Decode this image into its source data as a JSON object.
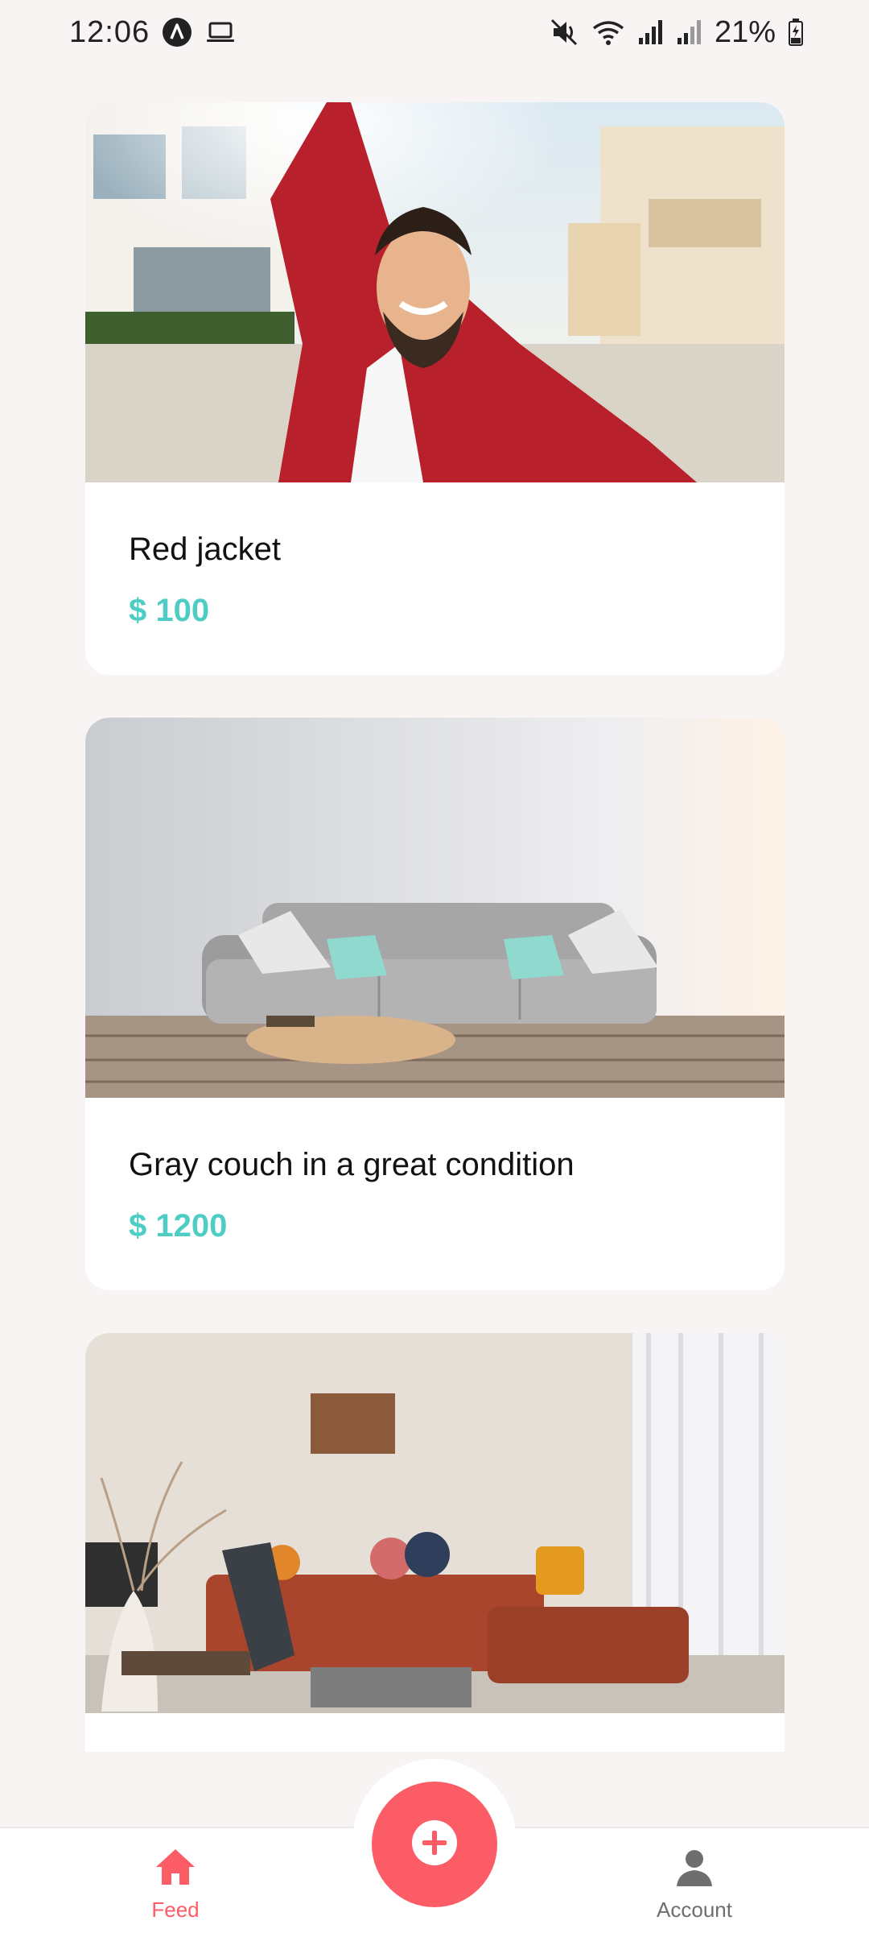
{
  "status_bar": {
    "time": "12:06",
    "battery": "21%",
    "icons_left": [
      "app-a-icon",
      "laptop-icon"
    ],
    "icons_right": [
      "mute-icon",
      "wifi-icon",
      "signal-icon",
      "signal-icon-2",
      "battery-icon"
    ]
  },
  "listings": [
    {
      "title": "Red jacket",
      "price": "$ 100",
      "image": "man-in-red-jacket-selfie"
    },
    {
      "title": "Gray couch in a great condition",
      "price": "$ 1200",
      "image": "gray-couch-living-room"
    },
    {
      "title": "",
      "price": "",
      "image": "rust-sectional-sofa-living-room"
    }
  ],
  "nav": {
    "feed_label": "Feed",
    "account_label": "Account",
    "add_icon": "plus-icon"
  },
  "colors": {
    "accent": "#fc5c65",
    "price": "#4ecdc4",
    "background": "#f8f4f4"
  }
}
